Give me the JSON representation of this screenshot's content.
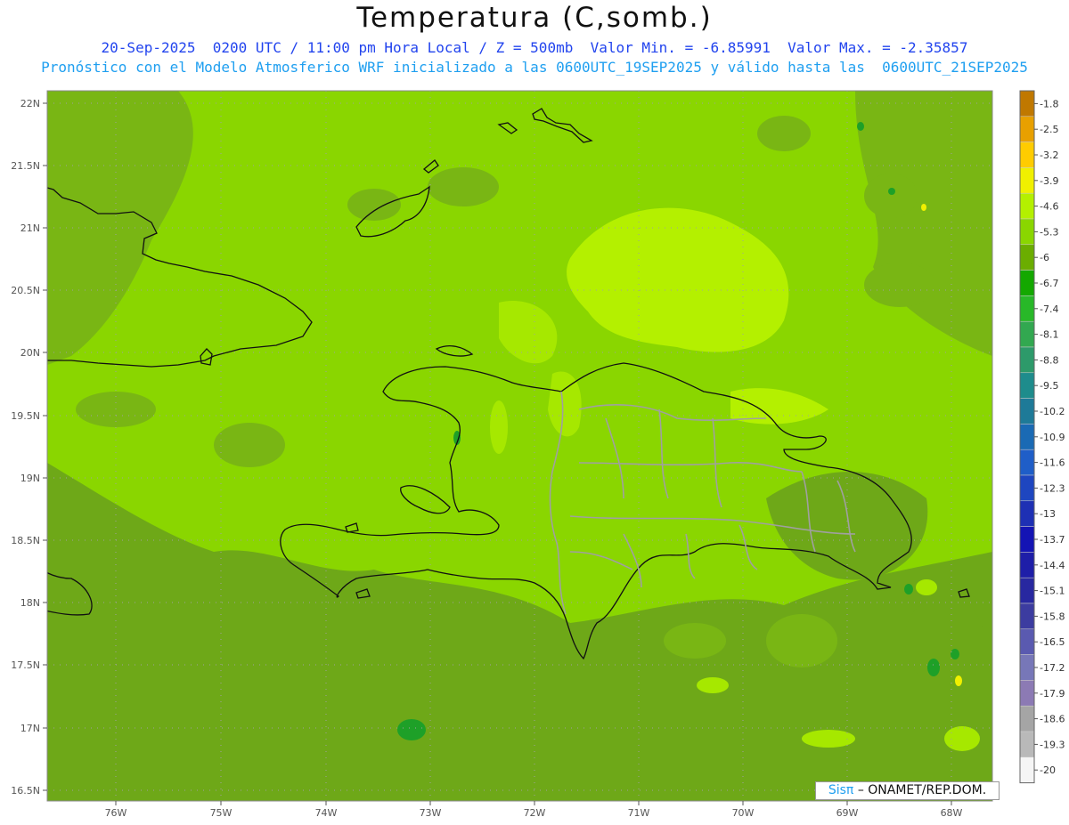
{
  "header": {
    "title": "Temperatura (C,somb.)",
    "subtitle_line1": "20-Sep-2025  0200 UTC / 11:00 pm Hora Local / Z = 500mb  Valor Min. = -6.85991  Valor Max. = -2.35857",
    "subtitle_line2": "Pronóstico con el Modelo Atmosferico WRF inicializado a las 0600UTC_19SEP2025 y válido hasta las  0600UTC_21SEP2025"
  },
  "axes": {
    "lat_labels": [
      "22N",
      "21.5N",
      "21N",
      "20.5N",
      "20N",
      "19.5N",
      "19N",
      "18.5N",
      "18N",
      "17.5N",
      "17N",
      "16.5N"
    ],
    "lon_labels": [
      "76W",
      "75W",
      "74W",
      "73W",
      "72W",
      "71W",
      "70W",
      "69W",
      "68W"
    ]
  },
  "legend": {
    "levels": [
      "-1.8",
      "-2.5",
      "-3.2",
      "-3.9",
      "-4.6",
      "-5.3",
      "-6",
      "-6.7",
      "-7.4",
      "-8.1",
      "-8.8",
      "-9.5",
      "-10.2",
      "-10.9",
      "-11.6",
      "-12.3",
      "-13",
      "-13.7",
      "-14.4",
      "-15.1",
      "-15.8",
      "-16.5",
      "-17.2",
      "-17.9",
      "-18.6",
      "-19.3",
      "-20"
    ],
    "colors": [
      "#c07800",
      "#e8a000",
      "#ffcc00",
      "#f0f000",
      "#b4f000",
      "#8ad600",
      "#6bad00",
      "#14a800",
      "#28b828",
      "#32a850",
      "#2d9a6a",
      "#1e8c8c",
      "#1e7a98",
      "#1a6ab4",
      "#1f5ec8",
      "#1e46c0",
      "#1e30b4",
      "#1414b4",
      "#1e1ea8",
      "#2828a0",
      "#3c3ca0",
      "#5a5ab0",
      "#7777b8",
      "#8c7ab4",
      "#a5a5a5",
      "#b9b9b9",
      "#f5f5f5"
    ]
  },
  "credit": {
    "brand": "Sisπ",
    "org": "– ONAMET/REP.DOM."
  },
  "map_colors": {
    "base": "#6ea818",
    "mid": "#8ad600",
    "light": "#b4f000",
    "dark": "#5e9a12",
    "green": "#1e9a28",
    "yellow": "#f0f000"
  }
}
